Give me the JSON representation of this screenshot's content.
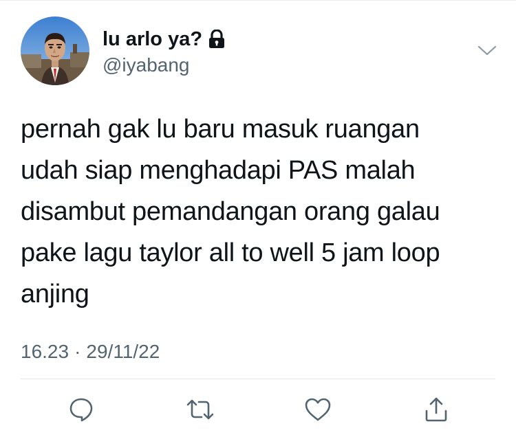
{
  "user": {
    "display_name": "lu arlo ya?",
    "username": "@iyabang",
    "protected": true
  },
  "tweet": {
    "text": "pernah gak lu baru masuk ruangan\nudah siap menghadapi PAS malah\ndisambut pemandangan orang galau\npake lagu taylor all to well 5 jam loop\nanjing",
    "time": "16.23",
    "separator": "·",
    "date": "29/11/22"
  },
  "actions": [
    {
      "icon": "reply-icon"
    },
    {
      "icon": "retweet-icon"
    },
    {
      "icon": "like-icon"
    },
    {
      "icon": "share-icon"
    }
  ],
  "colors": {
    "text_primary": "#0f1419",
    "text_secondary": "#536471",
    "icon": "#536471",
    "divider": "#e1e8ed"
  }
}
